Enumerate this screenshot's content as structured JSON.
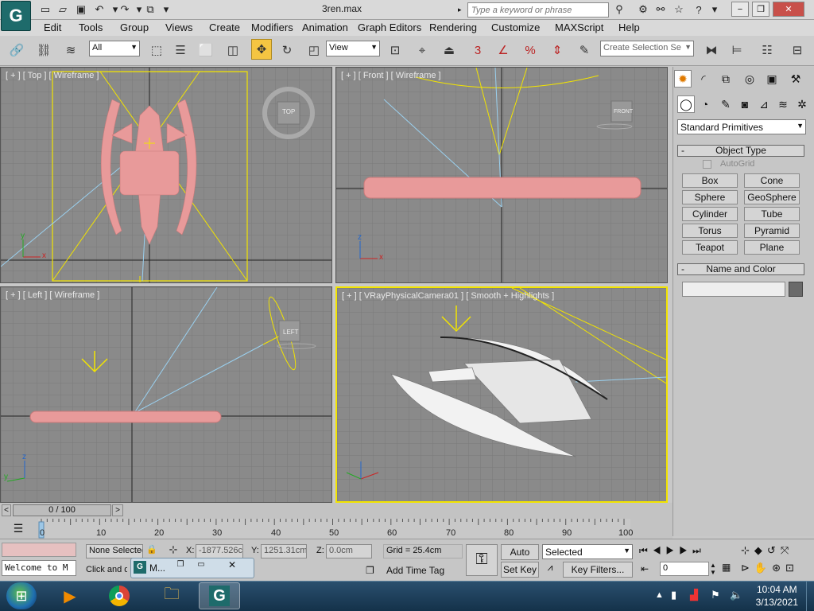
{
  "window": {
    "doc_title": "3ren.max",
    "search_placeholder": "Type a keyword or phrase",
    "logo": "G"
  },
  "menu": [
    "Edit",
    "Tools",
    "Group",
    "Views",
    "Create",
    "Modifiers",
    "Animation",
    "Graph Editors",
    "Rendering",
    "Customize",
    "MAXScript",
    "Help"
  ],
  "toolbar": {
    "filter_value": "All",
    "refcoord_value": "View",
    "selection_set_placeholder": "Create Selection Se",
    "snap_label": "3",
    "percent_label": "%"
  },
  "viewports": {
    "top": "[ + ] [ Top ] [ Wireframe ]",
    "front": "[ + ] [ Front ] [ Wireframe ]",
    "left": "[ + ] [ Left ] [ Wireframe ]",
    "camera": "[ + ] [ VRayPhysicalCamera01 ] [ Smooth + Highlights ]",
    "cube_top": "TOP",
    "cube_front": "FRONT",
    "cube_left": "LEFT",
    "axis_x": "x",
    "axis_y": "y",
    "axis_z": "z"
  },
  "command_panel": {
    "category_value": "Standard Primitives",
    "object_type_title": "Object Type",
    "autogrid_label": "AutoGrid",
    "buttons": [
      "Box",
      "Cone",
      "Sphere",
      "GeoSphere",
      "Cylinder",
      "Tube",
      "Torus",
      "Pyramid",
      "Teapot",
      "Plane"
    ],
    "name_color_title": "Name and Color",
    "name_value": "",
    "minus": "-"
  },
  "timeline": {
    "slider_label": "0 / 100",
    "ticks": [
      "0",
      "10",
      "20",
      "30",
      "40",
      "50",
      "60",
      "70",
      "80",
      "90",
      "100"
    ],
    "prev_arrow": "<",
    "next_arrow": ">"
  },
  "status": {
    "selection": "None Selected",
    "prompt": "Click and d",
    "maxscript_value": "Welcome to M",
    "x_label": "X:",
    "x_value": "-1877.526c",
    "y_label": "Y:",
    "y_value": "1251.31cm",
    "z_label": "Z:",
    "z_value": "0.0cm",
    "grid": "Grid = 25.4cm",
    "add_time_tag": "Add Time Tag",
    "auto_key": "Auto Key",
    "set_key": "Set Key",
    "key_mode_value": "Selected",
    "key_filters": "Key Filters...",
    "frame_value": "0",
    "taskbar_window_label": "M..."
  },
  "taskbar": {
    "time": "10:04 AM",
    "date": "3/13/2021"
  },
  "colors": {
    "viewport_bg": "#8a8a8a",
    "model_pink": "#e89a9a",
    "camera_yellow": "#f2e400",
    "active_border": "#f2e400"
  }
}
